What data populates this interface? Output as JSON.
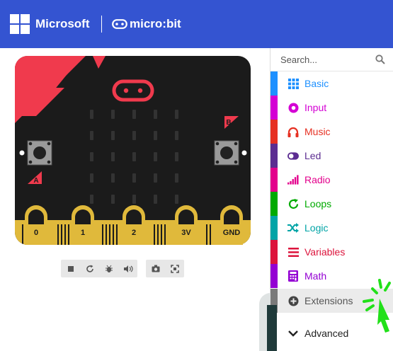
{
  "header": {
    "brand": "Microsoft",
    "product": "micro:bit",
    "background": "#3454d1"
  },
  "simulator": {
    "board_color": "#1b1b1b",
    "accent_color": "#f03a4d",
    "pin_color": "#e0b93b",
    "button_a": "A",
    "button_b": "B",
    "pins": [
      "0",
      "1",
      "2",
      "3V",
      "GND"
    ],
    "controls": [
      {
        "icon": "stop-icon"
      },
      {
        "icon": "restart-icon"
      },
      {
        "icon": "debug-icon"
      },
      {
        "icon": "mute-icon"
      },
      {
        "icon": "screenshot-icon"
      },
      {
        "icon": "fullscreen-icon"
      }
    ]
  },
  "toolbox": {
    "search": {
      "placeholder": "Search..."
    },
    "categories": [
      {
        "label": "Basic",
        "color": "#1e90ff",
        "icon": "grid-icon"
      },
      {
        "label": "Input",
        "color": "#d400d4",
        "icon": "circle-icon"
      },
      {
        "label": "Music",
        "color": "#e63022",
        "icon": "headphones-icon"
      },
      {
        "label": "Led",
        "color": "#5c2d91",
        "icon": "toggle-icon"
      },
      {
        "label": "Radio",
        "color": "#e3008c",
        "icon": "signal-icon"
      },
      {
        "label": "Loops",
        "color": "#00aa00",
        "icon": "refresh-icon"
      },
      {
        "label": "Logic",
        "color": "#00a4a6",
        "icon": "shuffle-icon"
      },
      {
        "label": "Variables",
        "color": "#dc143c",
        "icon": "list-icon"
      },
      {
        "label": "Math",
        "color": "#9400d3",
        "icon": "calculator-icon"
      },
      {
        "label": "Extensions",
        "color": "#7a7a7a",
        "icon": "plus-circle-icon"
      },
      {
        "label": "Advanced",
        "color": "#3c3c3c",
        "icon": "chevron-down-icon"
      }
    ]
  }
}
